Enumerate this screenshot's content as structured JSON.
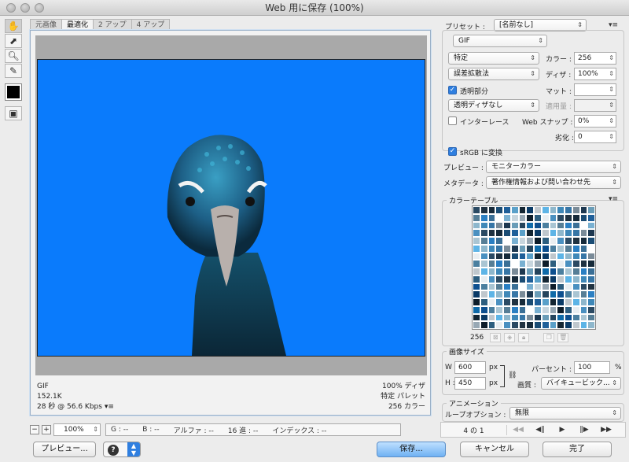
{
  "window": {
    "title": "Web 用に保存 (100%)"
  },
  "tools": [
    "hand-tool",
    "slice-select-tool",
    "zoom-tool",
    "eyedropper-tool"
  ],
  "tabs": [
    {
      "label": "元画像",
      "active": false
    },
    {
      "label": "最適化",
      "active": true
    },
    {
      "label": "2 アップ",
      "active": false
    },
    {
      "label": "4 アップ",
      "active": false
    }
  ],
  "canvas": {
    "bg_color": "#0a7bfc",
    "info_left": {
      "format": "GIF",
      "size": "152.1K",
      "time": "28 秒 @ 56.6 Kbps"
    },
    "info_right": {
      "dither": "100% ディザ",
      "palette": "特定 パレット",
      "colors": "256 カラー"
    }
  },
  "statusbar": {
    "zoom": "100%",
    "g": "G : --",
    "b": "B : --",
    "alpha": "アルファ : --",
    "hex": "16 進 : --",
    "index": "インデックス : --"
  },
  "buttons": {
    "preview": "プレビュー...",
    "save": "保存...",
    "cancel": "キャンセル",
    "done": "完了"
  },
  "settings": {
    "preset_label": "プリセット :",
    "preset_value": "[名前なし]",
    "format": "GIF",
    "reduction": "特定",
    "colors_label": "カラー :",
    "colors_value": "256",
    "dither_algo": "誤差拡散法",
    "dither_label": "ディザ :",
    "dither_value": "100%",
    "transparency_label": "透明部分",
    "transparency_checked": true,
    "matte_label": "マット :",
    "matte_value": "",
    "trans_dither": "透明ディザなし",
    "amount_label": "適用量 :",
    "amount_value": "",
    "interlace_label": "インターレース",
    "interlace_checked": false,
    "websnap_label": "Web スナップ :",
    "websnap_value": "0%",
    "lossy_label": "劣化 :",
    "lossy_value": "0",
    "srgb_label": "sRGB に変換",
    "srgb_checked": true,
    "preview_label": "プレビュー :",
    "preview_value": "モニターカラー",
    "metadata_label": "メタデータ :",
    "metadata_value": "著作権情報および問い合わせ先"
  },
  "color_table": {
    "title": "カラーテーブル",
    "count": "256",
    "palette": [
      "#2b4a63",
      "#3a6f96",
      "#1d3850",
      "#5aa0c9",
      "#0e1d2a",
      "#4b7f9f",
      "#8eb7cc",
      "#203241",
      "#ffffff",
      "#6a9db8",
      "#132532",
      "#2d5e7f",
      "#a9c5d3",
      "#3f88b8",
      "#162a3a",
      "#79b0d1",
      "#24445c",
      "#0a3a66",
      "#e9eef1",
      "#567e96",
      "#3776a6",
      "#1a4c74",
      "#c8d6de",
      "#0f6aa8",
      "#bfc7cd",
      "#4a90c0",
      "#2b7fc2",
      "#7a8b98",
      "#1f5f99",
      "#98a8b4",
      "#0d4f8f",
      "#5db4e6"
    ]
  },
  "image_size": {
    "title": "画像サイズ",
    "w_label": "W :",
    "w_value": "600",
    "h_label": "H :",
    "h_value": "450",
    "unit": "px",
    "percent_label": "パーセント :",
    "percent_value": "100",
    "percent_unit": "%",
    "quality_label": "画質 :",
    "quality_value": "バイキュービック..."
  },
  "animation": {
    "title": "アニメーション",
    "loop_label": "ループオプション :",
    "loop_value": "無限",
    "frame": "4 の 1"
  }
}
